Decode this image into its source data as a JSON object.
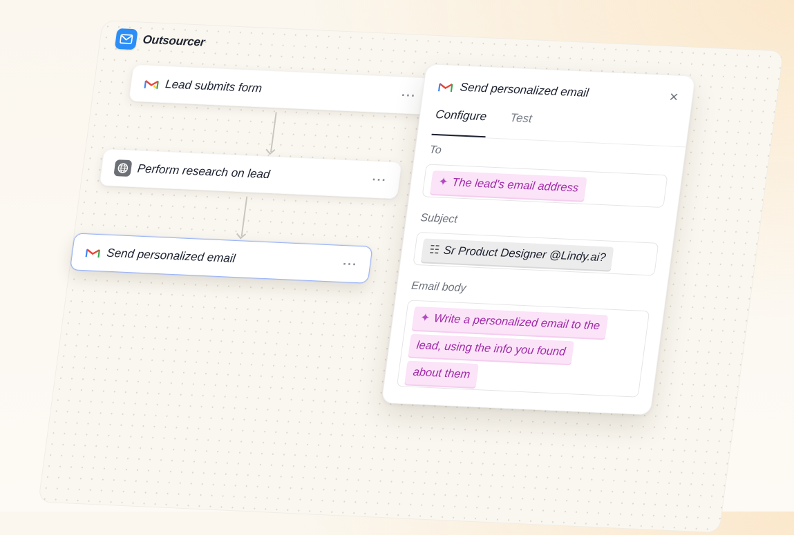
{
  "canvas": {
    "title": "Outsourcer"
  },
  "nodes": [
    {
      "label": "Lead submits form",
      "menu": "···",
      "icon": "gmail-icon"
    },
    {
      "label": "Perform research on lead",
      "menu": "···",
      "icon": "globe-icon"
    },
    {
      "label": "Send personalized email",
      "menu": "···",
      "icon": "gmail-icon"
    }
  ],
  "panel": {
    "title": "Send personalized email",
    "close": "×",
    "tabs": [
      {
        "label": "Configure"
      },
      {
        "label": "Test"
      }
    ],
    "to": {
      "label": "To",
      "value": "The lead's email address"
    },
    "subject": {
      "label": "Subject",
      "value": "Sr Product Designer @Lindy.ai?"
    },
    "body": {
      "label": "Email body",
      "lines": [
        "Write a personalized email to the",
        "lead, using the info you found",
        "about them"
      ]
    }
  },
  "colors": {
    "accent": "#2b8ef6",
    "ai_chip_bg": "#fbe3f8",
    "ai_chip_text": "#a02aa8",
    "selected_border": "#9bb4f7"
  }
}
